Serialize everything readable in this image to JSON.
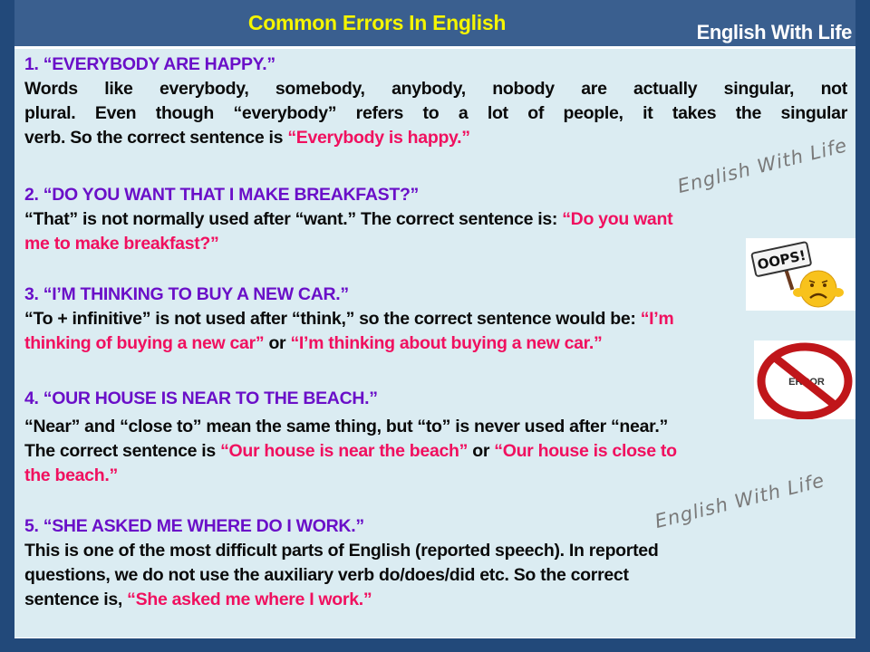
{
  "header": {
    "title": "Common Errors In English",
    "brand": "English With Life"
  },
  "watermark": "English With Life",
  "colors": {
    "heading": "#6a0fc8",
    "correction": "#f0105f",
    "title": "#f5f500",
    "frame": "#22497a"
  },
  "items": [
    {
      "heading": "1. “EVERYBODY ARE HAPPY.”",
      "body_lines": [
        "Words like everybody, somebody, anybody, nobody are actually singular, not",
        "plural. Even though “everybody” refers to a lot of people, it takes the singular"
      ],
      "line3_text": "verb. So the correct sentence is ",
      "line3_correction": "“Everybody is happy.”"
    },
    {
      "heading": "2. “DO YOU WANT THAT I MAKE BREAKFAST?”",
      "line1_text": "“That” is not normally used after “want.” The correct sentence is: ",
      "line1_correction": "“Do you want",
      "line2_correction": "me to make breakfast?”"
    },
    {
      "heading": "3. “I’M THINKING TO BUY A NEW CAR.”",
      "line1_text": "“To + infinitive” is not used after “think,” so the correct sentence would be: ",
      "line1_correction": "“I’m",
      "line2_correction_a": "thinking of buying a new car”",
      "line2_or": " or ",
      "line2_correction_b": "“I’m thinking about buying a new car.”"
    },
    {
      "heading": "4. “OUR HOUSE IS NEAR TO THE BEACH.”",
      "line1_text": "“Near” and “close to” mean the same thing, but “to” is never used after “near.”",
      "line2_text": "The correct sentence is ",
      "line2_correction_a": "“Our house is near the beach”",
      "line2_or": " or ",
      "line2_correction_b": "“Our house is close to",
      "line3_correction": "the beach.”"
    },
    {
      "heading": "5. “SHE ASKED ME WHERE DO I WORK.”",
      "line1_text": "This is one of the most difficult parts of English (reported speech). In reported",
      "line2_text": "questions, we do not use the auxiliary verb do/does/did etc. So the correct",
      "line3_text": "sentence is, ",
      "line3_correction": "“She asked me where I work.”"
    }
  ],
  "images": {
    "oops_sign": "OOPS!",
    "error_sign": "ERROR"
  }
}
